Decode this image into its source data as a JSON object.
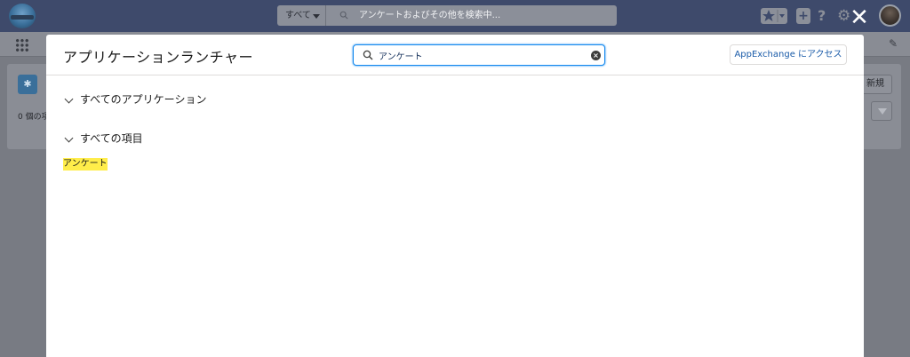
{
  "topbar": {
    "search_scope": "すべて",
    "search_placeholder": "アンケートおよびその他を検索中..."
  },
  "background": {
    "record_count": "0 個の項",
    "new_button": "新規"
  },
  "modal": {
    "title": "アプリケーションランチャー",
    "search": {
      "value": "アンケート"
    },
    "appexchange_button": "AppExchange にアクセス",
    "sections": [
      {
        "label": "すべてのアプリケーション",
        "expanded": false
      },
      {
        "label": "すべての項目",
        "expanded": true
      }
    ],
    "results": [
      {
        "label": "アンケート",
        "highlighted": true
      }
    ]
  },
  "colors": {
    "header": "#3e4a6b",
    "accent": "#1589ee",
    "highlight": "#ffed4a"
  }
}
